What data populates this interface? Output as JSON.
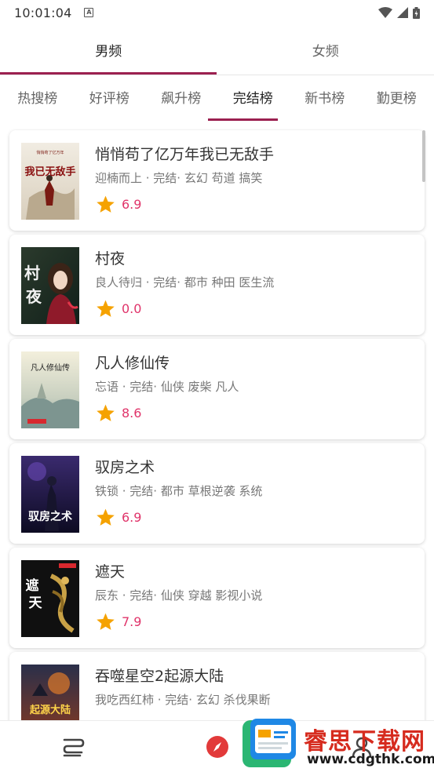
{
  "status_bar": {
    "time": "10:01:04",
    "notification_icon": "text-a-icon"
  },
  "gender_tabs": [
    {
      "label": "男频",
      "active": true
    },
    {
      "label": "女频",
      "active": false
    }
  ],
  "rank_tabs": [
    {
      "label": "热搜榜",
      "active": false
    },
    {
      "label": "好评榜",
      "active": false
    },
    {
      "label": "飙升榜",
      "active": false
    },
    {
      "label": "完结榜",
      "active": true
    },
    {
      "label": "新书榜",
      "active": false
    },
    {
      "label": "勤更榜",
      "active": false
    }
  ],
  "books": [
    {
      "title": "悄悄苟了亿万年我已无敌手",
      "meta": "迎楠而上 · 完结· 玄幻 苟道 搞笑",
      "score": "6.9",
      "cover_text": "我已无敌手"
    },
    {
      "title": "村夜",
      "meta": "良人待归 · 完结· 都市 种田 医生流",
      "score": "0.0",
      "cover_text": "村夜"
    },
    {
      "title": "凡人修仙传",
      "meta": "忘语 · 完结· 仙侠 废柴 凡人",
      "score": "8.6",
      "cover_text": "凡人修仙传"
    },
    {
      "title": "驭房之术",
      "meta": "铁锁 · 完结· 都市 草根逆袭 系统",
      "score": "6.9",
      "cover_text": "驭房之术"
    },
    {
      "title": "遮天",
      "meta": "辰东 · 完结· 仙侠 穿越 影视小说",
      "score": "7.9",
      "cover_text": "遮天"
    },
    {
      "title": "吞噬星空2起源大陆",
      "meta": "我吃西红柿 · 完结· 玄幻 杀伐果断",
      "score": "",
      "cover_text": "起源大陆"
    }
  ],
  "watermark": {
    "title": "睿思下载网",
    "url": "www.cdgthk.com"
  },
  "colors": {
    "accent": "#9b2050",
    "score": "#e0346a",
    "star": "#f5a200"
  }
}
